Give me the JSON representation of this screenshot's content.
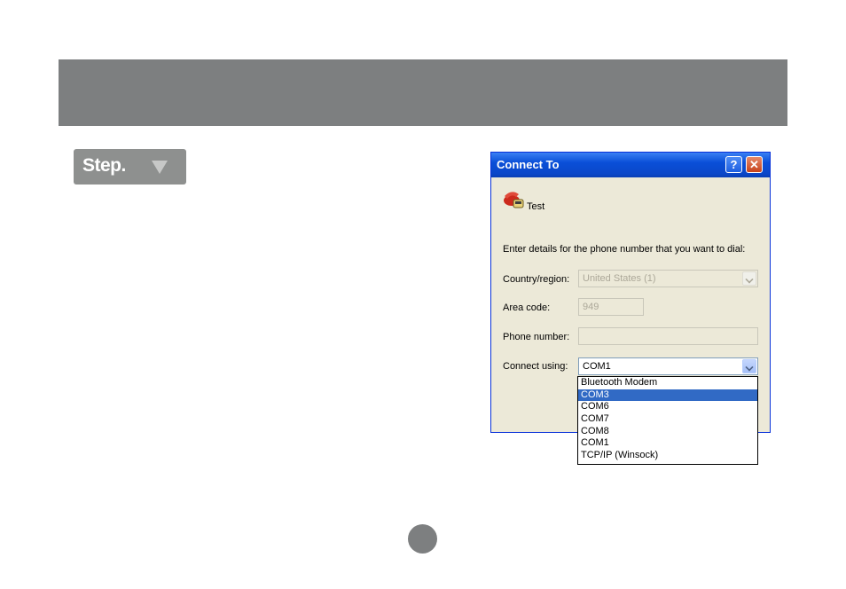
{
  "step": {
    "label": "Step."
  },
  "dialog": {
    "title": "Connect To",
    "help_label": "?",
    "close_label": "✕",
    "connection_name": "Test",
    "intro": "Enter details for the phone number that you want to dial:",
    "country_label": "Country/region:",
    "country_value": "United States (1)",
    "area_label": "Area code:",
    "area_value": "949",
    "phone_label": "Phone number:",
    "phone_value": "",
    "connect_label": "Connect using:",
    "connect_value": "COM1"
  },
  "dropdown": {
    "options": [
      "Bluetooth Modem",
      "COM3",
      "COM6",
      "COM7",
      "COM8",
      "COM1",
      "TCP/IP (Winsock)"
    ],
    "highlighted": "COM3"
  },
  "colors": {
    "title_bar": "#0a4fd8",
    "selection": "#316ac5",
    "band": "#7d7f80"
  },
  "icons": [
    "phone-icon",
    "help-icon",
    "close-icon",
    "chevron-down-icon",
    "triangle-down-icon"
  ]
}
